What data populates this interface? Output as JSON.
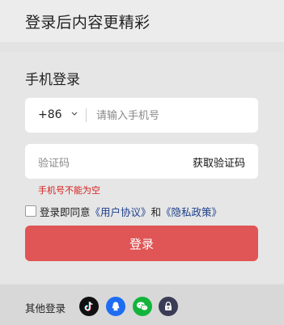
{
  "header": {
    "title": "登录后内容更精彩"
  },
  "login": {
    "section_title": "手机登录",
    "country_code": "+86",
    "phone_placeholder": "请输入手机号",
    "code_placeholder": "验证码",
    "get_code_label": "获取验证码",
    "error_message": "手机号不能为空",
    "agreement": {
      "prefix": "登录即同意",
      "user_agreement": "《用户协议》",
      "and": "和",
      "privacy_policy": "《隐私政策》"
    },
    "submit_label": "登录"
  },
  "footer": {
    "other_label": "其他登录",
    "icons": [
      "tiktok-icon",
      "qq-icon",
      "wechat-icon",
      "lock-icon"
    ]
  },
  "colors": {
    "primary_button": "#e05555",
    "error": "#d51e1e",
    "link": "#1d3f8a",
    "tiktok": "#111111",
    "qq": "#1e6cf2",
    "wechat": "#13b43c",
    "lock": "#3b3c55"
  }
}
